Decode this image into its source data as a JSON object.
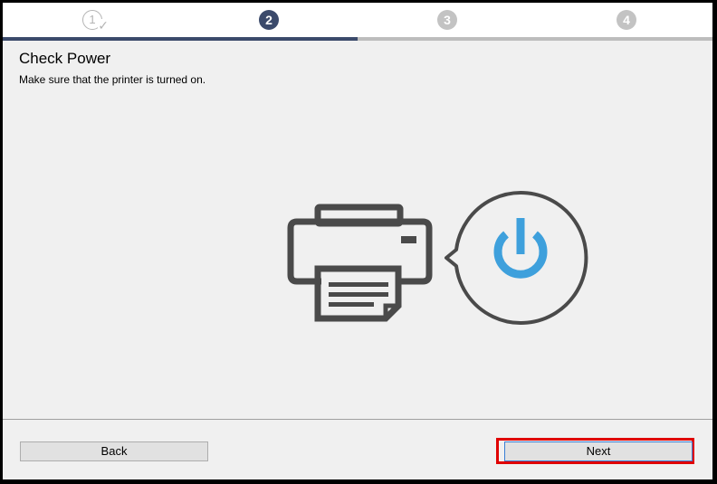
{
  "steps": {
    "items": [
      {
        "label": "1",
        "state": "done"
      },
      {
        "label": "2",
        "state": "current"
      },
      {
        "label": "3",
        "state": "todo"
      },
      {
        "label": "4",
        "state": "todo"
      }
    ],
    "progress": 0.5
  },
  "content": {
    "title": "Check Power",
    "description": "Make sure that the printer is turned on."
  },
  "illustration": {
    "icons": [
      "printer-icon",
      "power-icon"
    ],
    "outline_color": "#4a4a4a",
    "power_color": "#3ea0dc"
  },
  "buttons": {
    "back_label": "Back",
    "next_label": "Next"
  },
  "colors": {
    "step_current": "#3b4a6b",
    "step_todo": "#c3c3c3",
    "highlight": "#e00000"
  }
}
